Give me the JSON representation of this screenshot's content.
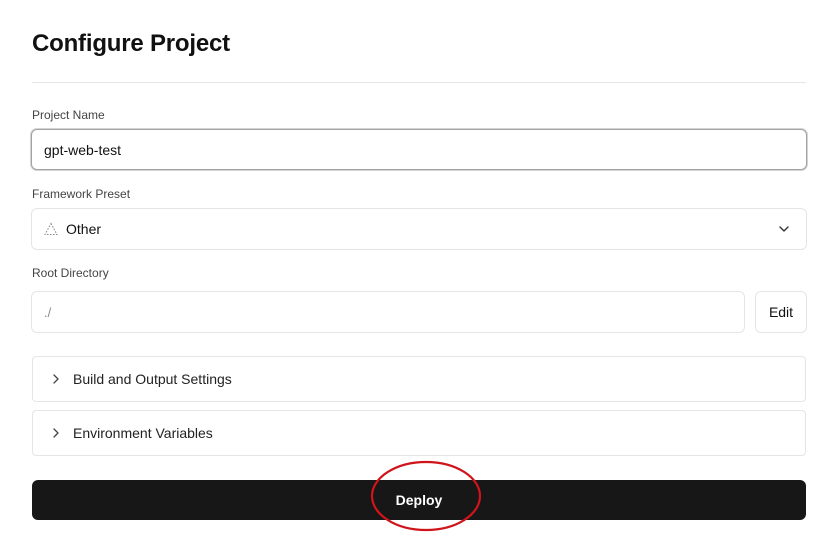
{
  "header": {
    "title": "Configure Project"
  },
  "project_name": {
    "label": "Project Name",
    "value": "gpt-web-test"
  },
  "framework_preset": {
    "label": "Framework Preset",
    "selected": "Other",
    "icon": "framework-triangle-icon"
  },
  "root_directory": {
    "label": "Root Directory",
    "value": "./",
    "edit_label": "Edit"
  },
  "sections": [
    {
      "label": "Build and Output Settings"
    },
    {
      "label": "Environment Variables"
    }
  ],
  "deploy": {
    "label": "Deploy"
  },
  "annotation": {
    "color": "#d0141c"
  }
}
